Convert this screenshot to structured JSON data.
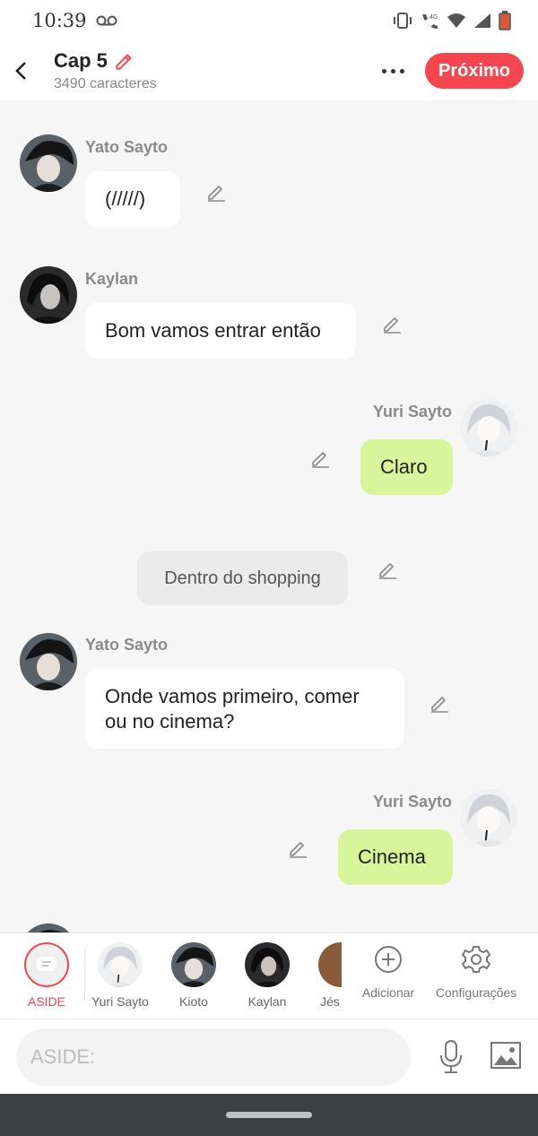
{
  "status_bar": {
    "time": "10:39",
    "network": "4G"
  },
  "header": {
    "title": "Cap 5",
    "subtitle": "3490 caracteres",
    "next_label": "Próximo"
  },
  "messages": [
    {
      "type": "left",
      "speaker": "Yato Sayto",
      "text": "(/////)"
    },
    {
      "type": "left",
      "speaker": "Kaylan",
      "text": "Bom vamos entrar então"
    },
    {
      "type": "right",
      "speaker": "Yuri Sayto",
      "text": "Claro"
    },
    {
      "type": "narration",
      "text": "Dentro do shopping"
    },
    {
      "type": "left",
      "speaker": "Yato Sayto",
      "text": "Onde vamos primeiro, comer ou no cinema?"
    },
    {
      "type": "right",
      "speaker": "Yuri Sayto",
      "text": "Cinema"
    }
  ],
  "characters": [
    {
      "label": "ASIDE"
    },
    {
      "label": "Yuri Sayto"
    },
    {
      "label": "Kioto"
    },
    {
      "label": "Kaylan"
    },
    {
      "label": "Jés"
    }
  ],
  "tools": {
    "add_label": "Adicionar",
    "settings_label": "Configurações"
  },
  "composer": {
    "placeholder": "ASIDE:"
  },
  "colors": {
    "accent": "#f5454f",
    "my_bubble": "#d9f59a",
    "background": "#f6f6f6"
  }
}
